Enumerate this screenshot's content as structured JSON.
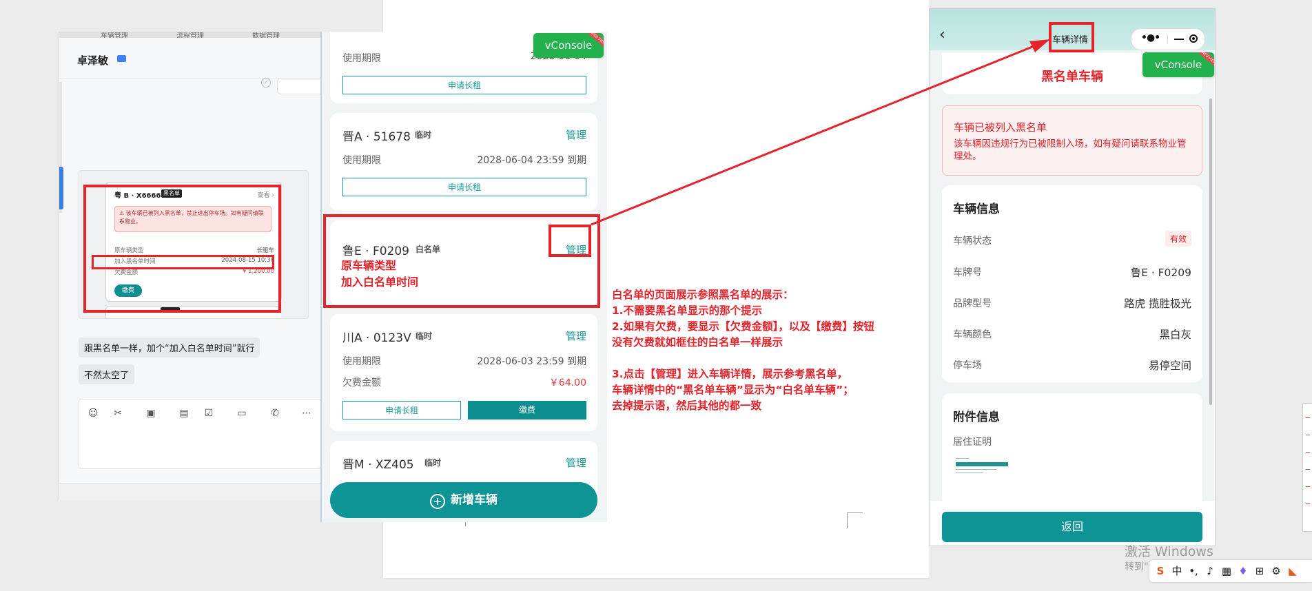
{
  "chat": {
    "strip_items": [
      "车辆管理",
      "流程管理",
      "数据管理"
    ],
    "contact_name": "卓泽敏",
    "screenshot": {
      "plate": "粤 B · X6666",
      "badge": "黑名单",
      "view_link": "查看 ›",
      "alert_text": "⚠ 该车辆已被列入黑名单，禁止进出停车场。如有疑问请联系物业。",
      "rows": [
        {
          "label": "原车辆类型",
          "value": "长租车"
        },
        {
          "label": "加入黑名单时间",
          "value": "2024-08-15 10:30"
        },
        {
          "label": "欠费金额",
          "value": "¥ 1,200.00"
        }
      ],
      "pay_button": "缴费"
    },
    "messages": [
      "跟黑名单一样，加个“加入白名单时间”就行",
      "不然太空了"
    ]
  },
  "vehicle_list": {
    "cards": [
      {
        "plate": "",
        "tag": "",
        "manage": "",
        "term_label": "使用期限",
        "term_value": "2028-06-04",
        "lease_button": "申请长租"
      },
      {
        "plate": "晋A · 51678",
        "tag": "临时",
        "manage": "管理",
        "term_label": "使用期限",
        "term_value": "2028-06-04 23:59 到期",
        "lease_button": "申请长租"
      },
      {
        "plate": "鲁E · F0209",
        "tag": "白名单",
        "manage": "管理",
        "annot_type": "原车辆类型",
        "annot_time": "加入白名单时间"
      },
      {
        "plate": "川A · 0123V",
        "tag": "临时",
        "manage": "管理",
        "term_label": "使用期限",
        "term_value": "2028-06-03 23:59 到期",
        "arrears_label": "欠费金额",
        "arrears_value": "￥64.00",
        "lease_button": "申请长租",
        "pay_button": "缴费"
      },
      {
        "plate": "晋M · XZ405",
        "tag": "临时",
        "manage": "管理"
      }
    ],
    "add_button": "新增车辆"
  },
  "vconsole_label": "vConsole",
  "vconsole_ribbon": "WEB VIEW",
  "instructions": [
    "白名单的页面展示参照黑名单的展示：",
    "1.不需要黑名单显示的那个提示",
    "2.如果有欠费，要显示【欠费金额】，以及【缴费】按钮",
    "没有欠费就如框住的白名单一样展示",
    "",
    "3.点击【管理】进入车辆详情，展示参考黑名单，",
    "车辆详情中的“黑名单车辆”显示为“白名单车辆”；",
    "去掉提示语，然后其他的都一致"
  ],
  "detail": {
    "title": "车辆详情",
    "status_title": "黑名单车辆",
    "alert_title": "车辆已被列入黑名单",
    "alert_desc": "该车辆因违规行为已被限制入场，如有疑问请联系物业管理处。",
    "info_title": "车辆信息",
    "rows": [
      {
        "label": "车辆状态",
        "value": "有效"
      },
      {
        "label": "车牌号",
        "value": "鲁E · F0209"
      },
      {
        "label": "品牌型号",
        "value": "路虎 揽胜极光"
      },
      {
        "label": "车辆颜色",
        "value": "黑白灰"
      },
      {
        "label": "停车场",
        "value": "易停空间"
      }
    ],
    "attach_title": "附件信息",
    "attach_label": "居住证明",
    "return_button": "返回"
  },
  "os": {
    "watermark_title": "激活 Windows",
    "watermark_sub": "转到\"设置\"以激活 Windows。",
    "ime_label": "中"
  },
  "colors": {
    "accent": "#0e9494",
    "annotation": "#e5232b",
    "vconsole": "#23b14d"
  }
}
